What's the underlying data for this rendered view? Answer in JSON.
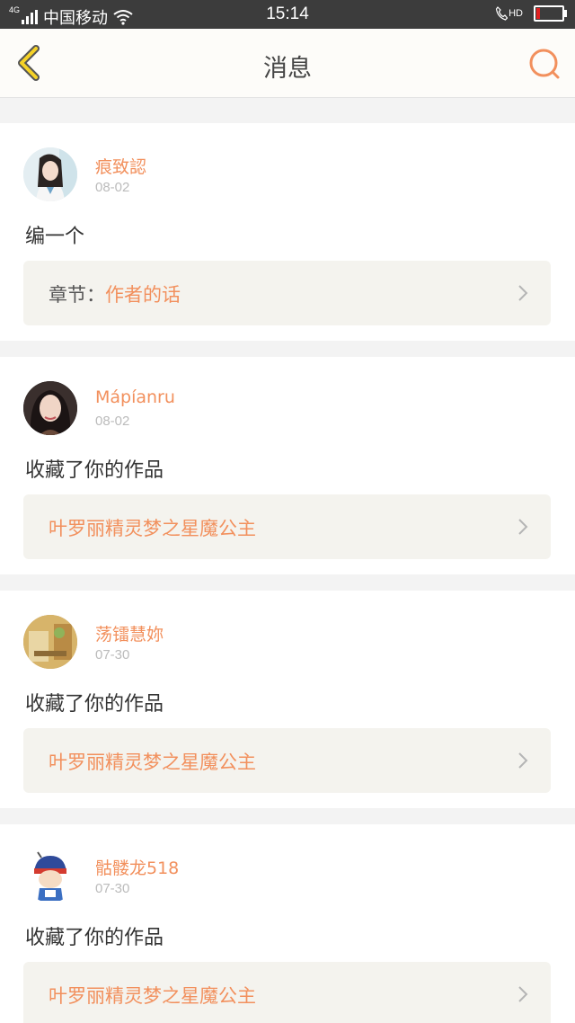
{
  "status_bar": {
    "network": "4G",
    "carrier": "中国移动",
    "time": "15:14",
    "call_label": "HD"
  },
  "header": {
    "title": "消息",
    "back_icon": "chevron-left-icon",
    "search_icon": "search-icon"
  },
  "colors": {
    "accent": "#f2905d",
    "back_yellow": "#f5d227",
    "ref_bg": "#f4f3ee"
  },
  "messages": [
    {
      "username": "痕致認",
      "date": "08-02",
      "text": "编一个",
      "ref_prefix": "章节：",
      "ref_title": "作者的话"
    },
    {
      "username": "Mápíanru",
      "date": "08-02",
      "text": "收藏了你的作品",
      "ref_prefix": "",
      "ref_title": "叶罗丽精灵梦之星魔公主"
    },
    {
      "username": "荡镭慧妳",
      "date": "07-30",
      "text": "收藏了你的作品",
      "ref_prefix": "",
      "ref_title": "叶罗丽精灵梦之星魔公主"
    },
    {
      "username": "骷髅龙518",
      "date": "07-30",
      "text": "收藏了你的作品",
      "ref_prefix": "",
      "ref_title": "叶罗丽精灵梦之星魔公主"
    }
  ]
}
